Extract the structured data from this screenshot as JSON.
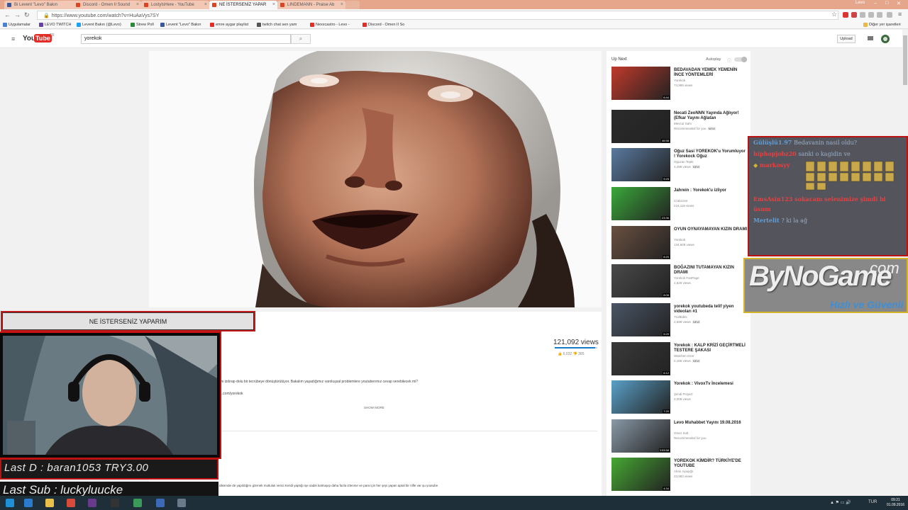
{
  "browser": {
    "tabs": [
      {
        "label": "Bi Levent \"Levo\" Bakın",
        "active": false
      },
      {
        "label": "Discord - Omen II Sound",
        "active": false
      },
      {
        "label": "LostyIsHere - YouTube",
        "active": false
      },
      {
        "label": "NE İSTERSENİZ YAPAR",
        "active": true
      },
      {
        "label": "LINDEMANN - Praise Ab",
        "active": false
      }
    ],
    "window_label": "Levo",
    "url": "https://www.youtube.com/watch?v=HuAaVys7SY",
    "bookmarks": [
      {
        "label": "Uygulamalar",
        "color": "#4a7fd6"
      },
      {
        "label": "LEVO TWITCH",
        "color": "#6441a5"
      },
      {
        "label": "Levent Bakın (@Levo)",
        "color": "#1da1f2"
      },
      {
        "label": "Strew Poll",
        "color": "#2a8a3a"
      },
      {
        "label": "Levent \"Levo\" Bakın",
        "color": "#3b5998"
      },
      {
        "label": "emre aygar playlist",
        "color": "#e52d27"
      },
      {
        "label": "twitch chat sen yam",
        "color": "#555555"
      },
      {
        "label": "Nexxcastro - Levo -",
        "color": "#e52d27"
      },
      {
        "label": "Discord - Omen II So",
        "color": "#e52d27"
      }
    ],
    "other_bookmarks": "Diğer yer işaretleri"
  },
  "youtube": {
    "logo_you": "You",
    "logo_tube": "Tube",
    "logo_region": "TR",
    "search_value": "yorekok",
    "upload_label": "Upload"
  },
  "video": {
    "views": "121,092 views",
    "likes": "6,032",
    "dislikes": "385",
    "description": "ve izdırap dolu bir tecrübeye dönüştürülüyor. Bakalım yaşadığımız varoluşsal problemlere youtuberımız cevap verebilecek mi?",
    "link": "...com/yorekok",
    "show_more": "SHOW MORE",
    "comment": "Yabancı ülkelerde var yapılan bir konseptin kendi ülkemde de yapıldığını görmek mutluluk verici.Kendi yaptığı işe sadık kalmayıp daha fazla izlenme ve para için her şeyi yapan aptal bir nifle var şu youtube"
  },
  "sidebar": {
    "up_next": "Up Next",
    "autoplay": "Autoplay",
    "items": [
      {
        "title": "BEDAVADAN YEMEK YEMENİN İNCE YÖNTEMLERİ",
        "channel": "Yorekok",
        "views": "74,989 views",
        "duration": "6:44",
        "badge": "",
        "color": "#c0392b"
      },
      {
        "title": "Necati ZeoNNN Yayında Ağlıyor! (Efkar Yayını Ağlatan",
        "channel": "Mevcut Sahi",
        "views": "Recommended for you",
        "duration": "46:58",
        "badge": "NEW",
        "color": "#2b2b2b"
      },
      {
        "title": "Oğuz Sasi YOREKOK'u Yorumluyor ! Yorekock Oğuz",
        "channel": "Oguzan Tepki",
        "views": "4,496 views",
        "duration": "9:25",
        "badge": "NEW",
        "color": "#5a7aa0"
      },
      {
        "title": "Jahrein : Yorekok'u izliyor",
        "channel": "Crabzone",
        "views": "216,118 views",
        "duration": "23:36",
        "badge": "",
        "color": "#3aa83a"
      },
      {
        "title": "OYUN OYNAYAMAYAN KIZIN DRAMI",
        "channel": "Yorekok",
        "views": "134,609 views",
        "duration": "8:20",
        "badge": "",
        "color": "#6a5040"
      },
      {
        "title": "BOĞAZINI TUTAMAYAN KIZIN DRAMI",
        "channel": "Yorekok FanPage",
        "views": "4,629 views",
        "duration": "8:06",
        "badge": "",
        "color": "#4a4a4a"
      },
      {
        "title": "yorekok youtubeda telif yiyen videoları #1",
        "channel": "TrollEdits",
        "views": "2,698 views",
        "duration": "5:29",
        "badge": "NEW",
        "color": "#4a5566"
      },
      {
        "title": "Yorekok : KALP KRİZİ GEÇİRTMELİ TESTERE ŞAKASI",
        "channel": "Watchen Ozer",
        "views": "2,186 views",
        "duration": "6:12",
        "badge": "NEW",
        "color": "#3a3a3a"
      },
      {
        "title": "Yorekok : VivoxTv İncelemesi",
        "channel": "Şimdi Project",
        "views": "2,008 views",
        "duration": "7:20",
        "badge": "",
        "color": "#5aa0c8"
      },
      {
        "title": "Levo Muhabbet Yayını 19.08.2016",
        "channel": "Omer Sult",
        "views": "Recommended for you",
        "duration": "3:53:58",
        "badge": "",
        "color": "#8a9aa8"
      },
      {
        "title": "YOREKOK KİMDİR? TÜRKİYE'DE YOUTUBE",
        "channel": "Ahmi Ayaşığlı",
        "views": "23,983 views",
        "duration": "4:34",
        "badge": "",
        "color": "#46a832"
      }
    ]
  },
  "stream_overlay": {
    "title": "NE İSTERSENİZ YAPARIM",
    "last_donation": "Last D : baran1053 TRY3.00",
    "last_sub": "Last Sub : luckyluucke"
  },
  "chat": {
    "lines": [
      {
        "user": "Gülüşlü1.97",
        "text": "Bedavanin nasil oldu?",
        "color": "#5ea0d8"
      },
      {
        "user": "hiphopjobz20",
        "text": "sanki o kagidin ve",
        "color": "#e84040"
      },
      {
        "user": "markosyy",
        "text": "",
        "color": "#e84040"
      },
      {
        "user": "EmsAsin123",
        "text": "sokacam selenimize şimdi bi üsum",
        "color": "#e84040"
      },
      {
        "user": "Mertelit",
        "text": "? ki la ağ",
        "color": "#5ea0d8"
      }
    ]
  },
  "sponsor": {
    "brand": "ByNoGame",
    "tld": ".com",
    "tagline": "Hızlı ve Güvenli"
  },
  "taskbar": {
    "language": "TUR",
    "time": "09:21",
    "date": "01.09.2016"
  }
}
